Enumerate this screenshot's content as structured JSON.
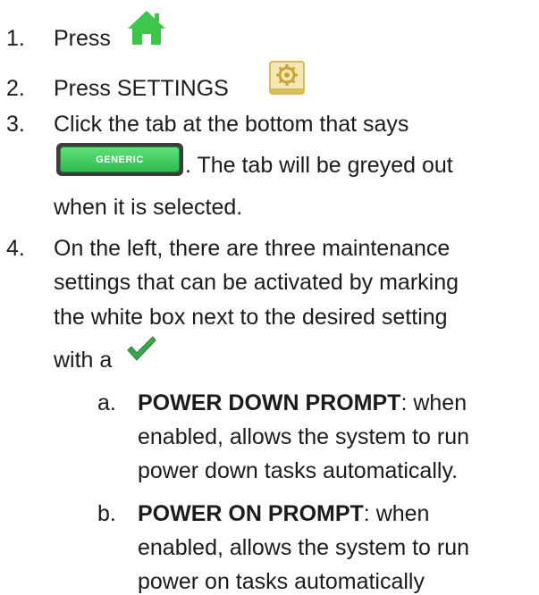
{
  "steps": [
    {
      "number": "1.",
      "text": "Press",
      "icon": "home-icon",
      "icon_color": "#3cc64a"
    },
    {
      "number": "2.",
      "text": "Press SETTINGS",
      "icon": "gear-settings-icon",
      "icon_color": "#e2c96a"
    },
    {
      "number": "3.",
      "line1": "Click the tab at the bottom that says",
      "button_label": "GENERIC",
      "button_color": "#39c95a",
      "line2": ". The tab will be greyed out",
      "line3": "when it is selected."
    },
    {
      "number": "4.",
      "line1": "On the left, there are three maintenance",
      "line2": "settings that can be activated by marking",
      "line3": "the white box next to the desired setting",
      "line4": "with a",
      "icon": "checkmark-icon",
      "icon_color": "#3aa54a"
    }
  ],
  "substeps": [
    {
      "letter": "a.",
      "title": "POWER DOWN PROMPT",
      "line1_rest": ": when",
      "line2": "enabled, allows the system to run",
      "line3": "power down tasks automatically."
    },
    {
      "letter": "b.",
      "title": "POWER ON PROMPT",
      "line1_rest": ": when",
      "line2": "enabled, allows the system to run",
      "line3": "power on tasks automatically"
    }
  ]
}
